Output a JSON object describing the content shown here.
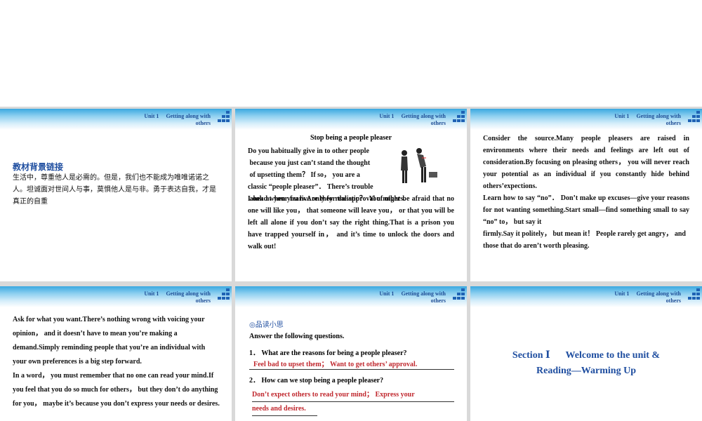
{
  "header": {
    "unit": "Unit 1",
    "topic_line1": "Getting along with",
    "topic_line2": "others"
  },
  "slide1": {
    "title": "教材背景链接",
    "body": "生活中，尊重他人是必需的。但是，我们也不能成为唯唯诺诺之人。坦诚面对世间人与事，莫惧他人是与非。勇于表达自我，才是真正的自重"
  },
  "slide2": {
    "title": "Stop being a people pleaser",
    "lines": [
      "Do you habitually give in to other people",
      " because you just can’t stand the thought",
      " of upsetting them？ If so， you are a",
      "classic “people pleaser”． There’s trouble",
      " ahead when you live only for the approval of others."
    ],
    "para2": "Look at your fears.Are they realistic？ You might be afraid that no one will like you， that someone will leave you， or that you will be left all alone if you don’t say the right thing.That is a prison you have trapped yourself in， and it’s time to unlock the doors and walk out!"
  },
  "slide3": {
    "para1": "Consider the source.Many people pleasers are raised in environments where their needs and feelings are left out of consideration.By focusing on pleasing others， you will never reach your potential as an individual if you constantly hide behind others’expections.",
    "para2": "Learn how to say “no”． Don’t make up excuses—give your reasons for not wanting something.Start small—find something small to say “no” to， but say it",
    "para3": "firmly.Say it politely， but mean it！ People rarely get angry， and those that do aren’t worth pleasing."
  },
  "slide4": {
    "para1": "Ask for what you want.There’s nothing wrong with voicing your opinion， and it doesn’t have to mean you’re making a demand.Simply reminding people that you’re an individual with your own preferences is a big step forward.",
    "para2": "In a word， you must remember that no one can read your mind.If you feel that you do so much for others， but they don’t do anything for you， maybe it’s because you don’t express your needs or desires."
  },
  "slide5": {
    "section": "◎品读小思",
    "instruction": "Answer the following questions.",
    "q1": "1． What are the reasons for being a people pleaser?",
    "a1": "Feel bad to upset them； Want to get others’ approval.",
    "q2": "2． How can we stop being a people pleaser?",
    "a2_line1": "Don’t expect others to read your mind； Express your",
    "a2_line2": "needs and desires."
  },
  "slide6": {
    "section": "Section Ⅰ",
    "title_rest": "Welcome to the unit &",
    "line2": "Reading—Warming Up"
  },
  "colors": {
    "accent_blue": "#1f4ea0",
    "answer_red": "#c0282e",
    "header_cyan": "#3aa8e0"
  }
}
